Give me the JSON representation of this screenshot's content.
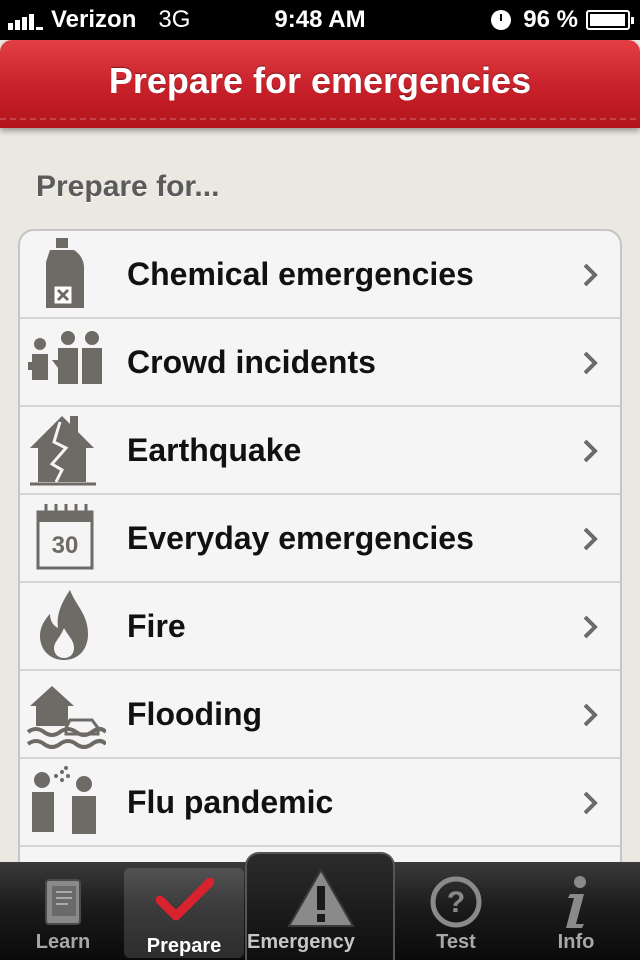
{
  "status_bar": {
    "carrier": "Verizon",
    "network": "3G",
    "time": "9:48 AM",
    "battery": "96 %",
    "battery_level": 0.96
  },
  "header": {
    "title": "Prepare for emergencies"
  },
  "section": {
    "label": "Prepare for..."
  },
  "items": [
    {
      "label": "Chemical emergencies",
      "icon": "chemical-bottle-icon"
    },
    {
      "label": "Crowd incidents",
      "icon": "crowd-icon"
    },
    {
      "label": "Earthquake",
      "icon": "earthquake-house-icon"
    },
    {
      "label": "Everyday emergencies",
      "icon": "calendar-icon",
      "icon_text": "30"
    },
    {
      "label": "Fire",
      "icon": "fire-icon"
    },
    {
      "label": "Flooding",
      "icon": "flooding-icon"
    },
    {
      "label": "Flu pandemic",
      "icon": "flu-sneeze-icon"
    }
  ],
  "tabs": [
    {
      "label": "Learn",
      "icon": "book-icon"
    },
    {
      "label": "Prepare",
      "icon": "checkmark-icon",
      "selected": true
    },
    {
      "label": "Emergency",
      "icon": "warning-triangle-icon"
    },
    {
      "label": "Test",
      "icon": "question-icon"
    },
    {
      "label": "Info",
      "icon": "info-icon"
    }
  ],
  "colors": {
    "header_red": "#c8202a",
    "background": "#ebe8e2",
    "icon_gray": "#6e6a66",
    "checkmark_red": "#d8232c"
  }
}
